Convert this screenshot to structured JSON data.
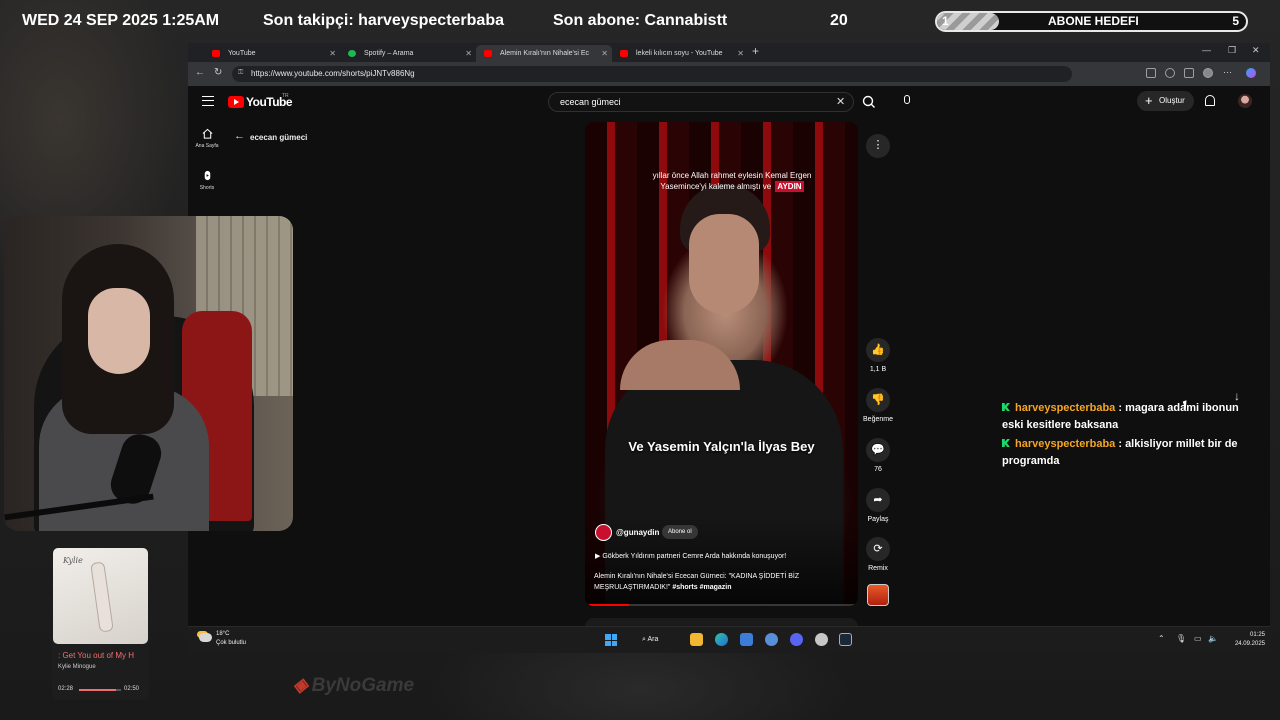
{
  "overlay": {
    "datetime": "WED 24 SEP 2025 1:25AM",
    "last_follower": "Son takipçi: harveyspecterbaba",
    "last_subscriber": "Son abone: Cannabistt",
    "count": "20",
    "goal": {
      "current": "1",
      "label": "ABONE HEDEFI",
      "target": "5",
      "progress": 0.2
    }
  },
  "browser": {
    "tabs": [
      {
        "label": "YouTube",
        "favicon_color": "#ff0000"
      },
      {
        "label": "Spotify – Arama",
        "favicon_color": "#1db954"
      },
      {
        "label": "Alemin Kıralı'nın Nihale'si Ec",
        "favicon_color": "#ff0000"
      },
      {
        "label": "lekeli kılıcın soyu - YouTube",
        "favicon_color": "#ff0000"
      }
    ],
    "new_tab": "+",
    "url": "https://www.youtube.com/shorts/piJNTv886Ng"
  },
  "youtube": {
    "logo": "YouTube",
    "country_code": "TR",
    "search_query": "ecec​an gümeci",
    "create_label": "Oluştur",
    "sidebar": [
      {
        "label": "Ana Sayfa",
        "icon": "home-icon"
      },
      {
        "label": "Shorts",
        "icon": "shorts-icon"
      }
    ],
    "channel_nav_title": "ececan gümeci",
    "video": {
      "top_caption": "yıllar önce Allah rahmet eylesin Kemal Ergen Yasemince'yi kaleme almıştı ve",
      "top_caption_tag": "AYDIN",
      "center_caption": "Ve Yasemin Yalçın'la İlyas Bey",
      "channel_handle": "@gunaydin",
      "subscribe_label": "Abone ol",
      "related": "Gökberk Yıldırım partneri Cemre Arda hakkında konuşuyor!",
      "description": "Alemin Kıralı'nın Nihale'si Ececan Gürneci: \"KADINA ŞİDDETİ BİZ MEŞRULAŞTIRMADIK!\"",
      "hashtags": "#shorts #magazin",
      "progress": 0.16
    },
    "actions": [
      {
        "name": "like",
        "label": "1,1 B",
        "icon": "thumbs-up-icon",
        "glyph": "👍"
      },
      {
        "name": "dislike",
        "label": "Beğenme",
        "icon": "thumbs-down-icon",
        "glyph": "👎"
      },
      {
        "name": "comments",
        "label": "76",
        "icon": "comment-icon",
        "glyph": "💬"
      },
      {
        "name": "share",
        "label": "Paylaş",
        "icon": "share-icon",
        "glyph": "➦"
      },
      {
        "name": "remix",
        "label": "Remix",
        "icon": "remix-icon",
        "glyph": "⟳"
      }
    ]
  },
  "taskbar": {
    "temperature": "18°C",
    "weather": "Çok bulutlu",
    "search_label": "Ara",
    "time": "01:25",
    "date": "24.09.2025"
  },
  "chat": [
    {
      "user": "harveyspecterbaba",
      "text": ": magara adami ibonun eski kesitlere baksana"
    },
    {
      "user": "harveyspecterbaba",
      "text": ": alkisliyor millet bir de programda"
    }
  ],
  "music": {
    "title": ": Get You out of My H",
    "artist": "Kylie Minogue",
    "current_time": "02:28",
    "total_time": "02:50",
    "progress": 0.87,
    "cover_script": "Kylie"
  },
  "watermark": "ByNoGame"
}
